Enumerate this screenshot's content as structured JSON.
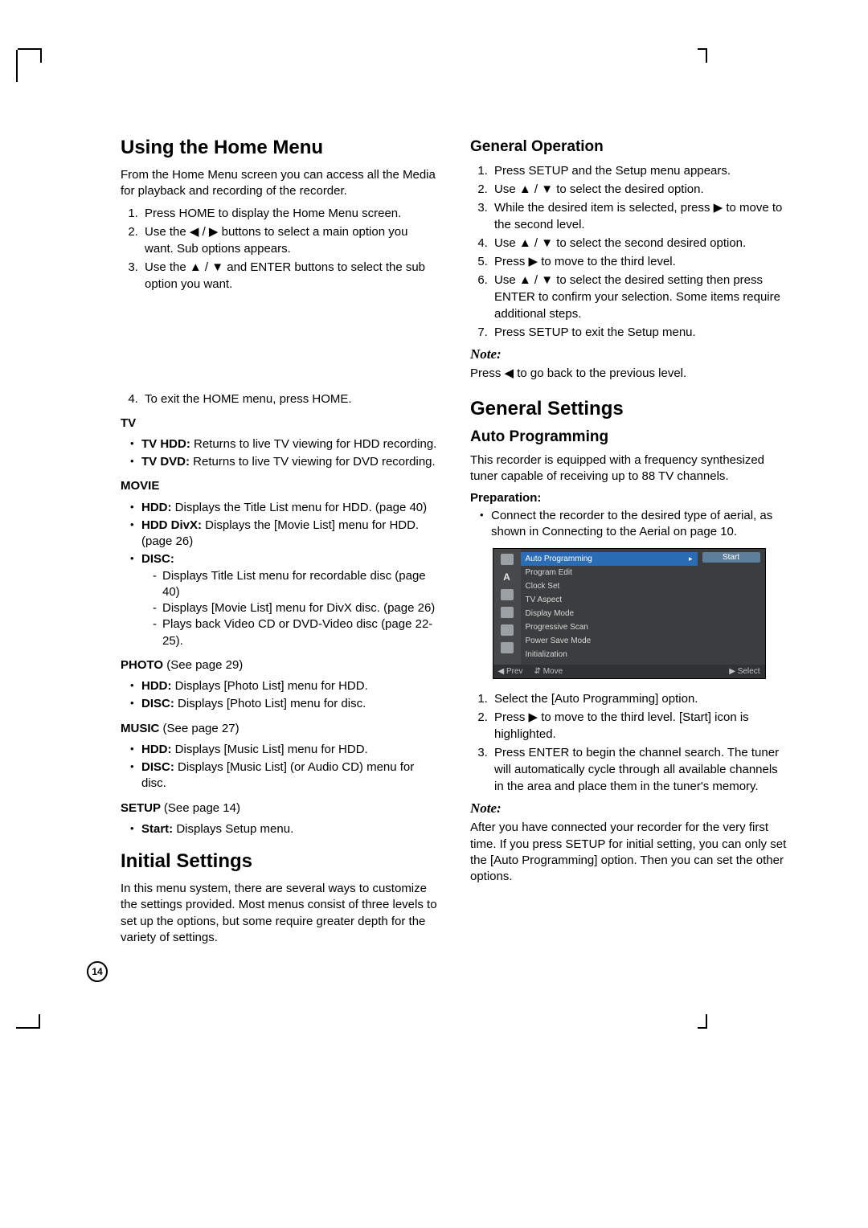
{
  "page_number": "14",
  "left": {
    "h1": "Using the Home Menu",
    "intro": "From the Home Menu screen you can access all the Media for playback and recording of the recorder.",
    "steps": [
      "Press HOME to display the Home Menu screen.",
      "Use the ◀ / ▶ buttons to select a main option you want. Sub options appears.",
      "Use the ▲ / ▼ and ENTER buttons to select the sub option you want."
    ],
    "step4": "To exit the HOME menu, press HOME.",
    "tv_head": "TV",
    "tv_items": [
      {
        "label": "TV HDD:",
        "text": " Returns to live TV viewing for HDD recording."
      },
      {
        "label": "TV DVD:",
        "text": " Returns to live TV viewing for DVD recording."
      }
    ],
    "movie_head": "MOVIE",
    "movie_items": [
      {
        "label": "HDD:",
        "text": " Displays the Title List menu for HDD. (page 40)"
      },
      {
        "label": "HDD DivX:",
        "text": " Displays the [Movie List] menu for HDD. (page 26)"
      }
    ],
    "disc_label": "DISC:",
    "disc_sub": [
      "Displays Title List menu for recordable disc (page 40)",
      "Displays [Movie List] menu for DivX disc. (page 26)",
      "Plays back Video CD or DVD-Video disc (page 22-25)."
    ],
    "photo_head": "PHOTO ",
    "photo_ref": "(See page 29)",
    "photo_items": [
      {
        "label": "HDD:",
        "text": " Displays [Photo List] menu for HDD."
      },
      {
        "label": "DISC:",
        "text": " Displays [Photo List] menu for disc."
      }
    ],
    "music_head": "MUSIC ",
    "music_ref": "(See page 27)",
    "music_items": [
      {
        "label": "HDD:",
        "text": " Displays [Music List] menu for HDD."
      },
      {
        "label": "DISC:",
        "text": " Displays [Music List] (or Audio CD) menu for disc."
      }
    ],
    "setup_head": "SETUP ",
    "setup_ref": "(See page 14)",
    "setup_items": [
      {
        "label": "Start:",
        "text": " Displays Setup menu."
      }
    ],
    "h1b": "Initial Settings",
    "initial_para": "In this menu system, there are several ways to customize the settings provided. Most menus consist of three levels to set up the options, but some require greater depth for the variety of settings."
  },
  "right": {
    "h2a": "General Operation",
    "gen_steps": [
      "Press SETUP and the Setup menu appears.",
      "Use ▲ / ▼ to select the desired option.",
      "While the desired item is selected, press ▶ to move to the second level.",
      "Use ▲ / ▼ to select the second desired option.",
      "Press ▶ to move to the third level.",
      "Use ▲ / ▼ to select the desired setting then press ENTER to confirm your selection. Some items require additional steps.",
      "Press SETUP to exit the Setup menu."
    ],
    "note_head": "Note:",
    "note1": "Press ◀ to go back to the previous level.",
    "h1c": "General Settings",
    "h2b": "Auto Programming",
    "auto_para": "This recorder is equipped with a frequency synthesized tuner capable of receiving up to 88 TV channels.",
    "prep_head": "Preparation:",
    "prep_items": [
      "Connect the recorder to the desired type of aerial, as shown in Connecting to the Aerial on page 10."
    ],
    "osd": {
      "items": [
        "Auto Programming",
        "Program Edit",
        "Clock Set",
        "TV Aspect",
        "Display Mode",
        "Progressive Scan",
        "Power Save Mode",
        "Initialization"
      ],
      "start": "Start",
      "foot_prev": "◀ Prev",
      "foot_move": "⇵ Move",
      "foot_select": "▶ Select"
    },
    "auto_steps": [
      "Select the [Auto Programming] option.",
      "Press ▶ to move to the third level. [Start] icon is highlighted.",
      "Press ENTER to begin the channel search. The tuner will automatically cycle through all available channels in the area and place them in the tuner's memory."
    ],
    "note2_head": "Note:",
    "note2": "After you have connected your recorder for the very first time. If you press SETUP for initial setting, you can only set the [Auto Programming] option. Then you can set the other options."
  }
}
